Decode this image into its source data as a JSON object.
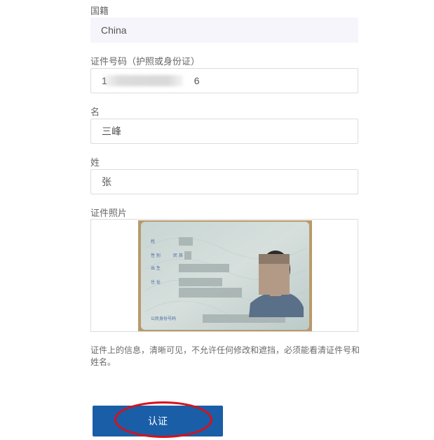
{
  "form": {
    "nationality": {
      "label": "国籍",
      "value": "China"
    },
    "id_number": {
      "label": "证件号码（护照或身份证）",
      "value_prefix": "1",
      "value_suffix": "6"
    },
    "first_name": {
      "label": "名",
      "value": "三峰"
    },
    "last_name": {
      "label": "姓",
      "value": "张"
    },
    "id_photo": {
      "label": "证件照片",
      "card_fields": [
        "姓",
        "性 别",
        "民 族",
        "出 生",
        "住 址"
      ],
      "card_id_label": "公民身份号码"
    },
    "note": "证件上的信息，清晰可见，不允许任何修改和遮挡，必须能看清证件号和姓名。",
    "submit_label": "认证"
  },
  "colors": {
    "button": "#1a5ea8",
    "highlight": "#d9101a",
    "readonly_bg": "#f6f5fb"
  }
}
